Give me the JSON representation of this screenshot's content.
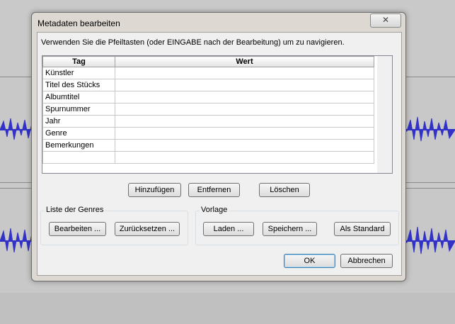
{
  "dialog": {
    "title": "Metadaten bearbeiten",
    "close_glyph": "✕",
    "hint": "Verwenden Sie die Pfeiltasten (oder EINGABE nach der Bearbeitung) um zu navigieren."
  },
  "grid": {
    "headers": [
      "Tag",
      "Wert"
    ],
    "rows": [
      {
        "tag": "Künstler",
        "value": ""
      },
      {
        "tag": "Titel des Stücks",
        "value": ""
      },
      {
        "tag": "Albumtitel",
        "value": ""
      },
      {
        "tag": "Spurnummer",
        "value": ""
      },
      {
        "tag": "Jahr",
        "value": ""
      },
      {
        "tag": "Genre",
        "value": ""
      },
      {
        "tag": "Bemerkungen",
        "value": ""
      },
      {
        "tag": "",
        "value": ""
      }
    ]
  },
  "row_buttons": {
    "add": "Hinzufügen",
    "remove": "Entfernen",
    "clear": "Löschen"
  },
  "genres": {
    "label": "Liste der Genres",
    "edit": "Bearbeiten ...",
    "reset": "Zurücksetzen ..."
  },
  "template": {
    "label": "Vorlage",
    "load": "Laden ...",
    "save": "Speichern ...",
    "set_default": "Als Standard"
  },
  "footer": {
    "ok": "OK",
    "cancel": "Abbrechen"
  },
  "colors": {
    "waveform": "#3232c8",
    "track_bg": "#c8c8c8",
    "dialog_bg": "#f0f0f0"
  }
}
